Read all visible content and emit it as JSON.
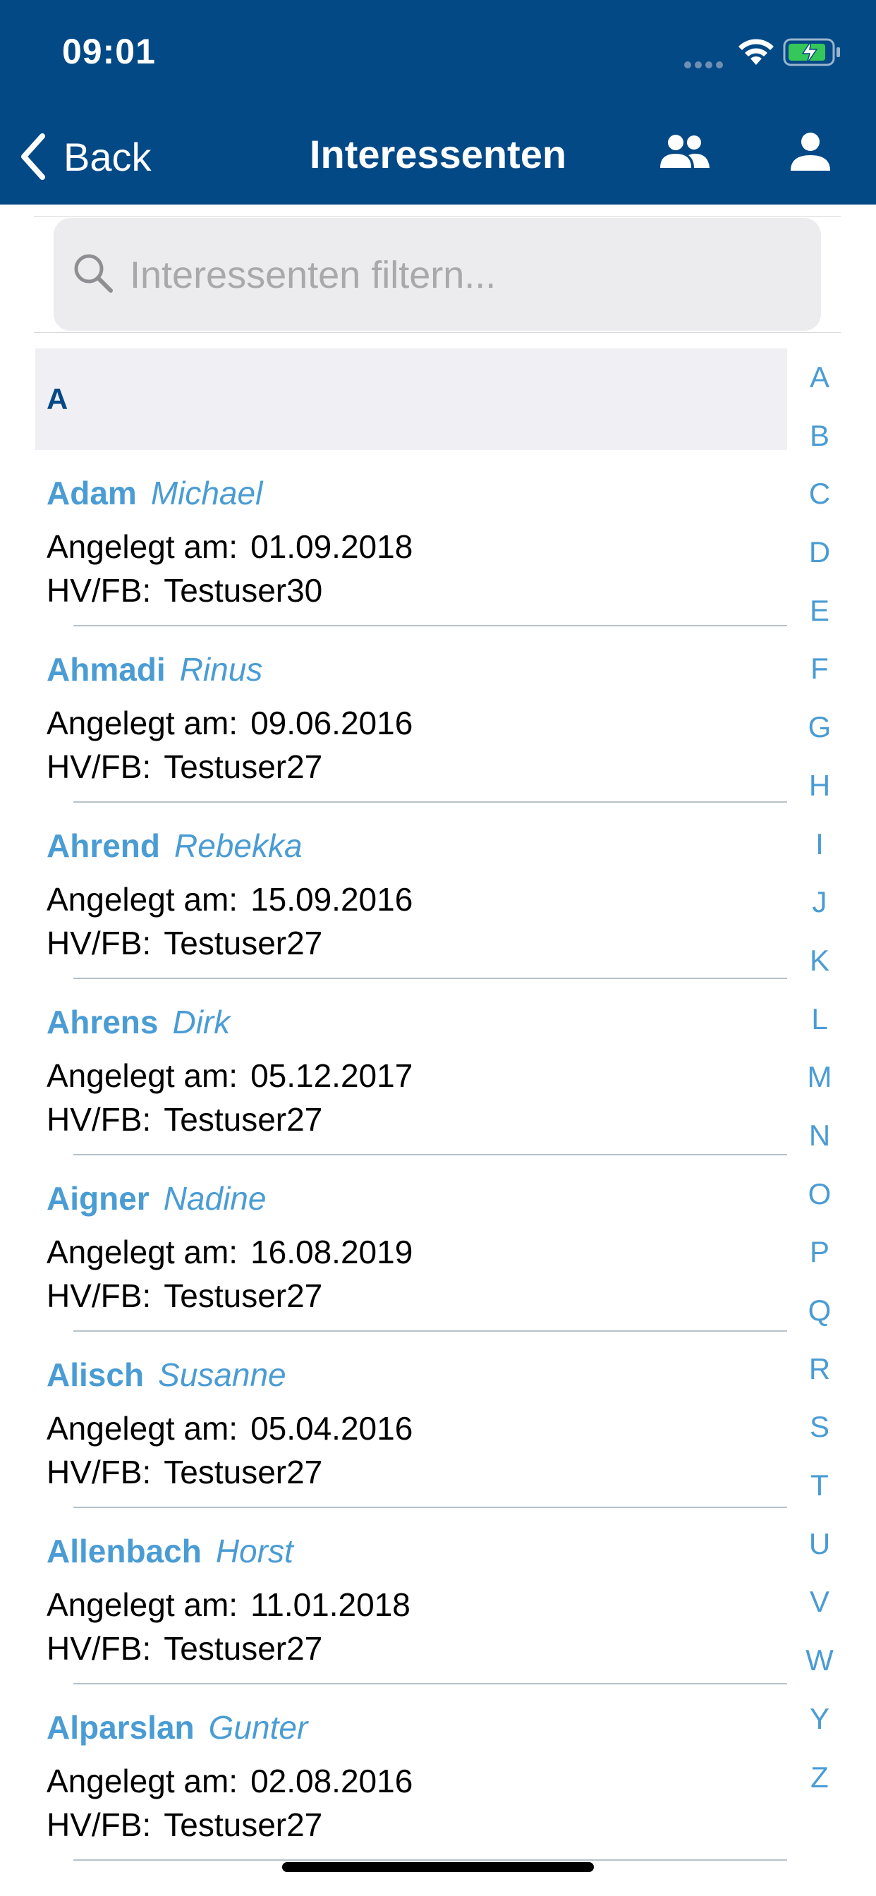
{
  "status": {
    "time": "09:01"
  },
  "nav": {
    "back_label": "Back",
    "title": "Interessenten"
  },
  "search": {
    "placeholder": "Interessenten filtern..."
  },
  "section": {
    "letter": "A"
  },
  "labels": {
    "created": "Angelegt am:",
    "owner": "HV/FB:"
  },
  "items": [
    {
      "last": "Adam",
      "first": "Michael",
      "date": "01.09.2018",
      "user": "Testuser30"
    },
    {
      "last": "Ahmadi",
      "first": "Rinus",
      "date": "09.06.2016",
      "user": "Testuser27"
    },
    {
      "last": "Ahrend",
      "first": "Rebekka",
      "date": "15.09.2016",
      "user": "Testuser27"
    },
    {
      "last": "Ahrens",
      "first": "Dirk",
      "date": "05.12.2017",
      "user": "Testuser27"
    },
    {
      "last": "Aigner",
      "first": "Nadine",
      "date": "16.08.2019",
      "user": "Testuser27"
    },
    {
      "last": "Alisch",
      "first": "Susanne",
      "date": "05.04.2016",
      "user": "Testuser27"
    },
    {
      "last": "Allenbach",
      "first": "Horst",
      "date": "11.01.2018",
      "user": "Testuser27"
    },
    {
      "last": "Alparslan",
      "first": "Gunter",
      "date": "02.08.2016",
      "user": "Testuser27"
    }
  ],
  "index": [
    "A",
    "B",
    "C",
    "D",
    "E",
    "F",
    "G",
    "H",
    "I",
    "J",
    "K",
    "L",
    "M",
    "N",
    "O",
    "P",
    "Q",
    "R",
    "S",
    "T",
    "U",
    "V",
    "W",
    "Y",
    "Z"
  ],
  "colors": {
    "header": "#034986",
    "accent": "#4a9cd4",
    "section_bg": "#efeff4"
  }
}
